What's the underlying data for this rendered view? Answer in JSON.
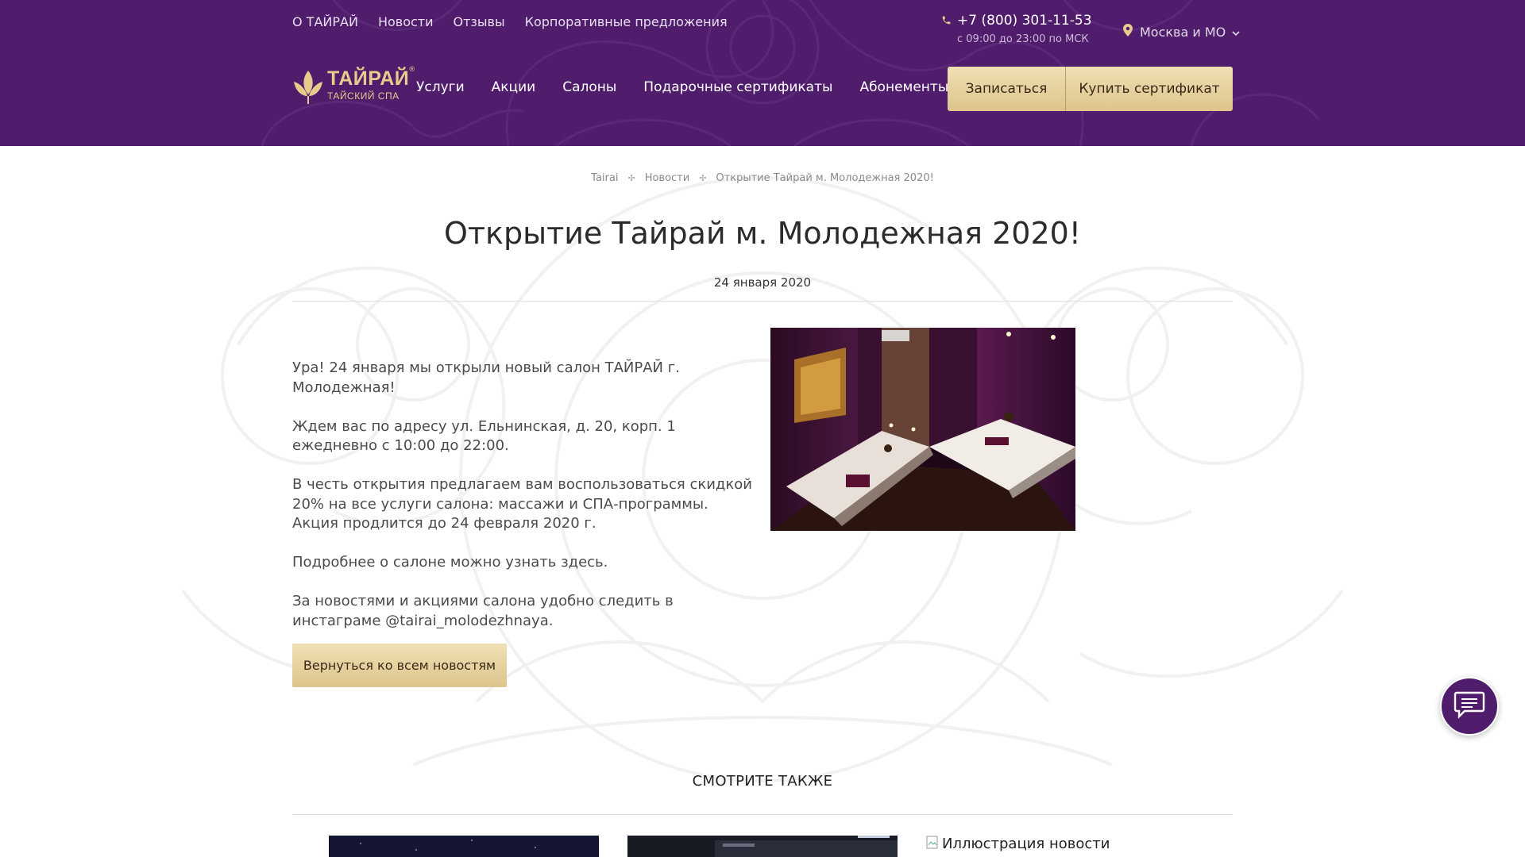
{
  "colors": {
    "brand_purple": "#4f1d6b",
    "gold": "#e6cb8c",
    "button_gold": "#e6d4a2"
  },
  "top_links": [
    "О ТАЙРАЙ",
    "Новости",
    "Отзывы",
    "Корпоративные предложения"
  ],
  "contact": {
    "phone": "+7 (800) 301-11-53",
    "hours": "с 09:00 до 23:00 по МСК",
    "city": "Москва и МО"
  },
  "logo": {
    "title": "ТАЙРАЙ",
    "subtitle": "ТАЙСКИЙ СПА",
    "reg_mark": "®"
  },
  "main_nav": [
    "Услуги",
    "Акции",
    "Салоны",
    "Подарочные сертификаты",
    "Абонементы"
  ],
  "header_buttons": {
    "signup": "Записаться",
    "buy_certificate": "Купить сертификат"
  },
  "breadcrumb": {
    "home": "Tairai",
    "section": "Новости",
    "current": "Открытие Тайрай м. Молодежная 2020!",
    "separator": "✢"
  },
  "article": {
    "title": "Открытие Тайрай м. Молодежная 2020!",
    "date": "24 января 2020",
    "paragraphs": [
      "Ура! 24 января мы открыли новый салон ТАЙРАЙ г. Молодежная!",
      "Ждем вас по адресу ул. Ельнинская, д. 20, корп. 1 ежедневно с 10:00 до 22:00.",
      "В честь открытия предлагаем вам воспользоваться скидкой 20% на все услуги салона: массажи и СПА-программы. Акция продлится до 24 февраля 2020 г."
    ],
    "details_text": "Подробнее о салоне можно узнать ",
    "details_link": "здесь",
    "details_end": ".",
    "instagram_text": "За новостями и акциями салона удобно следить в инстаграме @tairai_molodezhnaya."
  },
  "back_button": "Вернуться ко всем новостям",
  "see_also": {
    "title": "СМОТРИТЕ ТАКЖЕ",
    "broken_image_alt": "Иллюстрация новости"
  },
  "icons": {
    "phone": "phone-icon",
    "location": "location-pin-icon",
    "chevron": "chevron-down-icon",
    "chat": "chat-icon"
  }
}
